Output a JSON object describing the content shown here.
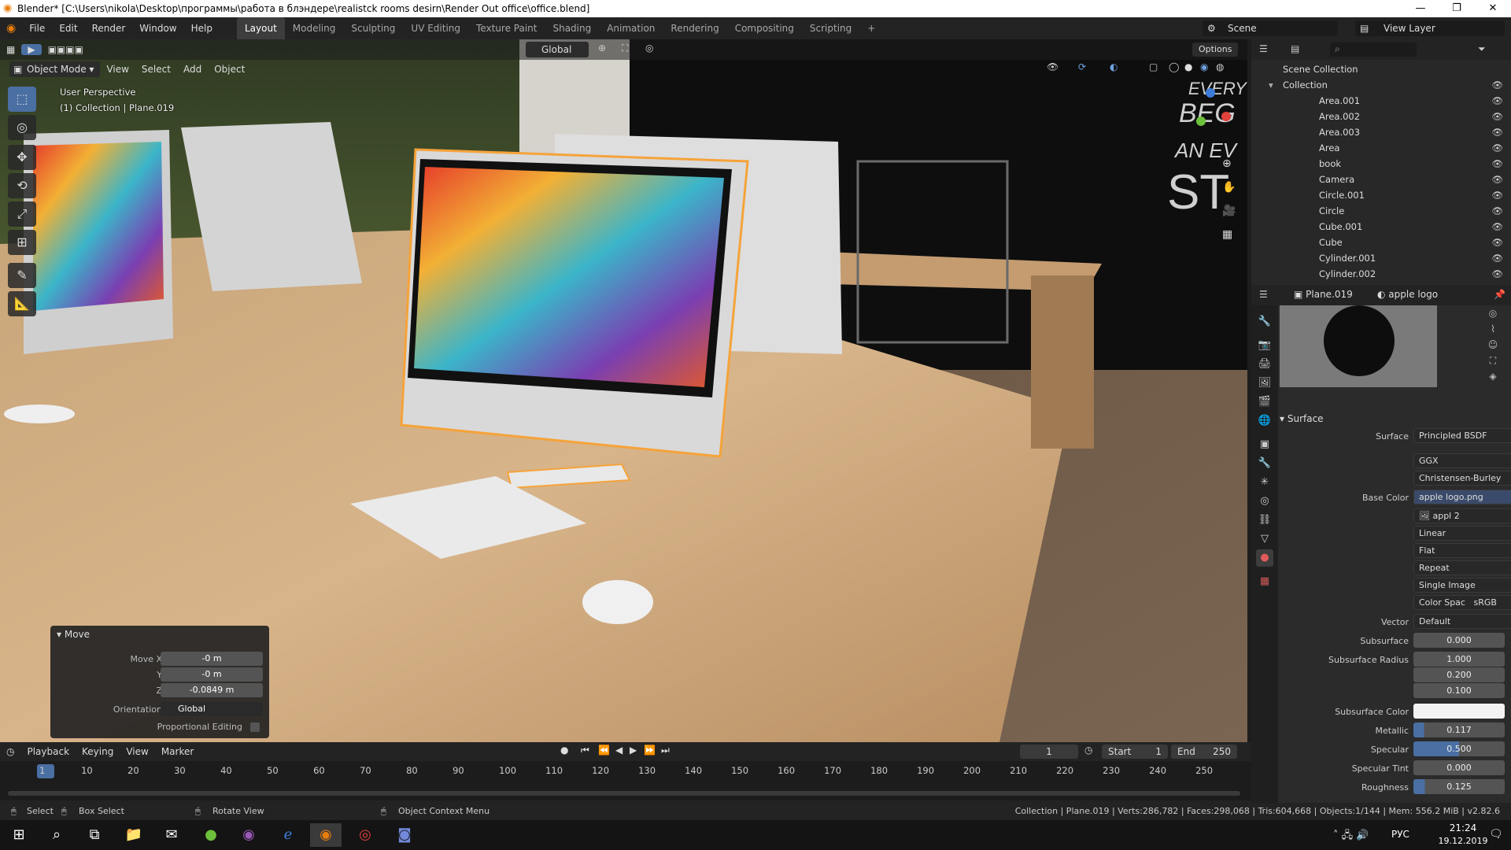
{
  "window": {
    "title": "Blender* [C:\\Users\\nikola\\Desktop\\программы\\работа в блэндере\\realistck rooms desirn\\Render Out office\\office.blend]"
  },
  "menu": {
    "items": [
      "File",
      "Edit",
      "Render",
      "Window",
      "Help"
    ]
  },
  "workspaces": [
    "Layout",
    "Modeling",
    "Sculpting",
    "UV Editing",
    "Texture Paint",
    "Shading",
    "Animation",
    "Rendering",
    "Compositing",
    "Scripting"
  ],
  "scene": {
    "label": "Scene",
    "view_layer": "View Layer"
  },
  "viewport": {
    "mode": "Object Mode",
    "menus": [
      "View",
      "Select",
      "Add",
      "Object"
    ],
    "orientation": "Global",
    "options": "Options",
    "overlay_title": "User Perspective",
    "overlay_sub": "(1) Collection | Plane.019"
  },
  "move_panel": {
    "title": "Move",
    "rows": [
      {
        "label": "Move X",
        "value": "-0 m"
      },
      {
        "label": "Y",
        "value": "-0 m"
      },
      {
        "label": "Z",
        "value": "-0.0849 m"
      }
    ],
    "orientation_label": "Orientation",
    "orientation_value": "Global",
    "proportional": "Proportional Editing"
  },
  "outliner": {
    "root": "Scene Collection",
    "collection": "Collection",
    "items": [
      "Area.001",
      "Area.002",
      "Area.003",
      "Area",
      "book",
      "Camera",
      "Circle.001",
      "Circle",
      "Cube.001",
      "Cube",
      "Cylinder.001",
      "Cylinder.002"
    ]
  },
  "properties": {
    "object": "Plane.019",
    "material": "apple logo",
    "section": "Surface",
    "surface_label": "Surface",
    "surface_value": "Principled BSDF",
    "distribution": "GGX",
    "subsurface_method": "Christensen-Burley",
    "base_color_label": "Base Color",
    "base_color_value": "apple logo.png",
    "image_name": "appl",
    "image_users": "2",
    "interp": "Linear",
    "projection": "Flat",
    "extension": "Repeat",
    "source": "Single Image",
    "color_space_label": "Color Spac",
    "color_space_value": "sRGB",
    "vector_label": "Vector",
    "vector_value": "Default",
    "subsurface_label": "Subsurface",
    "subsurface_value": "0.000",
    "ss_radius_label": "Subsurface Radius",
    "ss_radius": [
      "1.000",
      "0.200",
      "0.100"
    ],
    "ss_color_label": "Subsurface Color",
    "metallic_label": "Metallic",
    "metallic_value": "0.117",
    "specular_label": "Specular",
    "specular_value": "0.500",
    "spec_tint_label": "Specular Tint",
    "spec_tint_value": "0.000",
    "roughness_label": "Roughness",
    "roughness_value": "0.125"
  },
  "timeline": {
    "menus": [
      "Playback",
      "Keying",
      "View",
      "Marker"
    ],
    "current": "1",
    "start_label": "Start",
    "start": "1",
    "end_label": "End",
    "end": "250",
    "ticks": [
      "1",
      "10",
      "20",
      "30",
      "40",
      "50",
      "60",
      "70",
      "80",
      "90",
      "100",
      "110",
      "120",
      "130",
      "140",
      "150",
      "160",
      "170",
      "180",
      "190",
      "200",
      "210",
      "220",
      "230",
      "240",
      "250"
    ]
  },
  "status": {
    "select": "Select",
    "box": "Box Select",
    "rotate": "Rotate View",
    "context": "Object Context Menu",
    "stats": "Collection | Plane.019 | Verts:286,782 | Faces:298,068 | Tris:604,668 | Objects:1/144 | Mem: 556.2 MiB | v2.82.6"
  },
  "taskbar": {
    "lang": "РУС",
    "time": "21:24",
    "date": "19.12.2019"
  },
  "colors": {
    "accent": "#4a6fa3",
    "selected_outline": "#f5a33a",
    "bg": "#232323"
  }
}
